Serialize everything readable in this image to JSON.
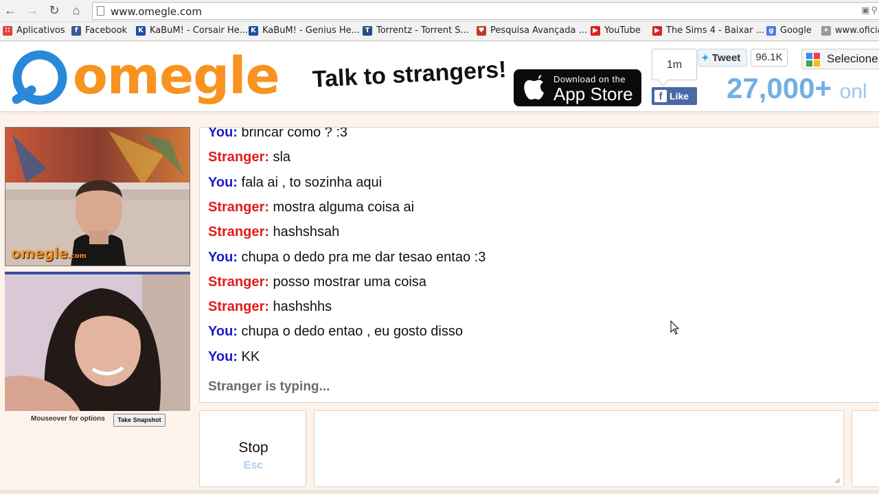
{
  "browser": {
    "url": "www.omegle.com",
    "bookmarks": [
      {
        "label": "Aplicativos",
        "icon": "apps-grid-icon",
        "color": "#e0453a"
      },
      {
        "label": "Facebook",
        "icon": "facebook-icon",
        "color": "#3b5998"
      },
      {
        "label": "KaBuM! - Corsair He...",
        "icon": "kabum-icon",
        "color": "#1a4fa0"
      },
      {
        "label": "KaBuM! - Genius He...",
        "icon": "kabum-icon",
        "color": "#1a4fa0"
      },
      {
        "label": "Torrentz - Torrent S...",
        "icon": "torrentz-icon",
        "color": "#2a4c8c"
      },
      {
        "label": "Pesquisa Avançada ...",
        "icon": "pesquisa-icon",
        "color": "#c0392b"
      },
      {
        "label": "YouTube",
        "icon": "youtube-icon",
        "color": "#d8231b"
      },
      {
        "label": "The Sims 4 - Baixar ...",
        "icon": "youtube-icon",
        "color": "#d8231b"
      },
      {
        "label": "Google",
        "icon": "google-icon",
        "color": "#4a7be0"
      },
      {
        "label": "www.oficia",
        "icon": "link-icon",
        "color": "#999999"
      }
    ]
  },
  "header": {
    "logo_text": "omegle",
    "tagline": "Talk to strangers!",
    "appstore_small": "Download on the",
    "appstore_big": "App Store",
    "like_count": "1m",
    "like_label": "Like",
    "tweet_label": "Tweet",
    "tweet_count": "96.1K",
    "select_label": "Selecione",
    "online_count": "27,000+",
    "online_suffix": "onl",
    "brand_color": "#f7931e"
  },
  "video": {
    "watermark": "omegle",
    "watermark_suffix": ".com",
    "mouseover_text": "Mouseover for options",
    "snapshot_label": "Take Snapshot"
  },
  "chat": {
    "messages": [
      {
        "who": "You:",
        "role": "you",
        "text": "brincar como ? :3"
      },
      {
        "who": "Stranger:",
        "role": "stranger",
        "text": "sla"
      },
      {
        "who": "You:",
        "role": "you",
        "text": "fala ai , to sozinha aqui"
      },
      {
        "who": "Stranger:",
        "role": "stranger",
        "text": "mostra alguma coisa ai"
      },
      {
        "who": "Stranger:",
        "role": "stranger",
        "text": "hashshsah"
      },
      {
        "who": "You:",
        "role": "you",
        "text": "chupa o dedo pra me dar tesao entao :3"
      },
      {
        "who": "Stranger:",
        "role": "stranger",
        "text": "posso mostrar uma coisa"
      },
      {
        "who": "Stranger:",
        "role": "stranger",
        "text": "hashshhs"
      },
      {
        "who": "You:",
        "role": "you",
        "text": "chupa o dedo entao , eu gosto disso"
      },
      {
        "who": "You:",
        "role": "you",
        "text": "KK"
      }
    ],
    "typing_status": "Stranger is typing..."
  },
  "controls": {
    "stop_label": "Stop",
    "esc_label": "Esc"
  }
}
